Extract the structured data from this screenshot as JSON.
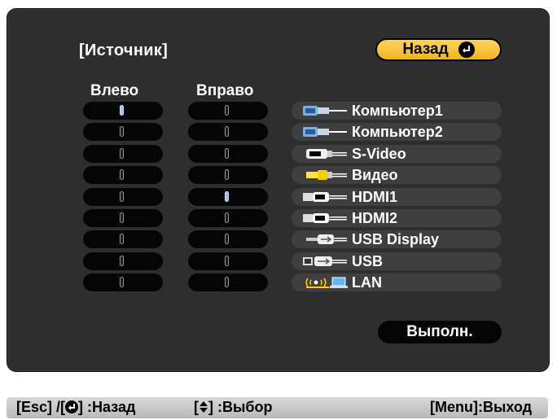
{
  "header": {
    "title": "[Источник]",
    "back_label": "Назад"
  },
  "columns": {
    "left": "Влево",
    "right": "Вправо"
  },
  "left_selected_index": 0,
  "right_selected_index": 4,
  "sources": [
    {
      "label": "Компьютер1",
      "icon": "vga-cable-icon"
    },
    {
      "label": "Компьютер2",
      "icon": "vga-cable-icon"
    },
    {
      "label": "S-Video",
      "icon": "svideo-cable-icon"
    },
    {
      "label": "Видео",
      "icon": "rca-video-cable-icon"
    },
    {
      "label": "HDMI1",
      "icon": "hdmi-cable-icon"
    },
    {
      "label": "HDMI2",
      "icon": "hdmi-cable-icon"
    },
    {
      "label": "USB Display",
      "icon": "usb-cable-icon"
    },
    {
      "label": "USB",
      "icon": "usb-b-cable-icon"
    },
    {
      "label": "LAN",
      "icon": "wireless-lan-icon"
    }
  ],
  "execute_label": "Выполн.",
  "footer": {
    "back_hint": "[Esc] /[",
    "back_hint_end": "] :Назад",
    "select_hint_start": "[",
    "select_hint_end": "] :Выбор",
    "exit_hint": "[Menu]:Выход"
  },
  "colors": {
    "panel": "#2e2e2e",
    "accent": "#f2b21f",
    "selected": "#8fc3ff"
  }
}
